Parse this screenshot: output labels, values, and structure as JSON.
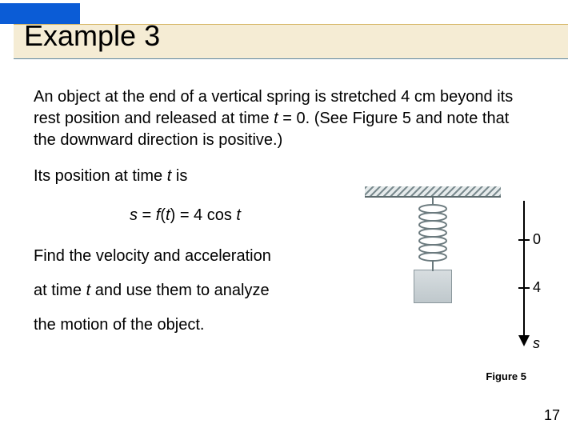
{
  "header": {
    "title": "Example 3"
  },
  "body": {
    "p1": "An object at the end of a vertical spring is stretched 4 cm beyond its rest position and released at time ",
    "p1_t": "t",
    "p1_after": " = 0. (See Figure 5 and note that the downward direction is positive.)",
    "p2_a": "Its position at time ",
    "p2_t": "t",
    "p2_b": " is",
    "eq_s": "s",
    "eq_eq1": " = ",
    "eq_f": "f",
    "eq_paren_open": "(",
    "eq_t": "t",
    "eq_paren_close": ")",
    "eq_eq2": " = 4 cos ",
    "eq_t2": "t",
    "l3": "Find the velocity and acceleration",
    "l4_a": "at time ",
    "l4_t": "t",
    "l4_b": " and use them to analyze",
    "l5": "the motion of the object."
  },
  "figure": {
    "axis_zero": "0",
    "axis_four": "4",
    "axis_s": "s",
    "caption": "Figure 5"
  },
  "page": {
    "num": "17"
  }
}
